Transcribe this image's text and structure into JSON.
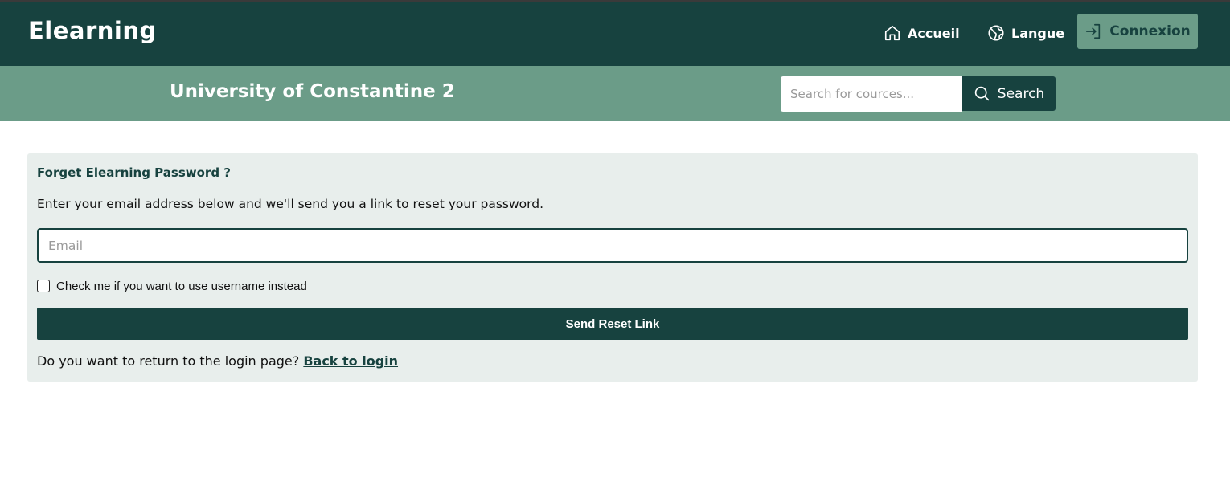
{
  "header": {
    "brand": "Elearning",
    "nav": {
      "home_label": "Accueil",
      "home_icon": "home-icon",
      "language_label": "Langue",
      "language_icon": "globe-icon"
    },
    "login_label": "Connexion",
    "login_icon": "login-arrow-icon"
  },
  "subheader": {
    "title": "University of Constantine 2",
    "search": {
      "placeholder": "Search for cources...",
      "value": "",
      "button_label": "Search",
      "button_icon": "search-icon"
    }
  },
  "reset_form": {
    "title": "Forget Elearning Password ?",
    "description": "Enter your email address below and we'll send you a link to reset your password.",
    "email_placeholder": "Email",
    "email_value": "",
    "checkbox_label": "Check me if you want to use username instead",
    "checkbox_checked": false,
    "submit_label": "Send Reset Link",
    "return_text": "Do you want to return to the login page?",
    "return_link": "Back to login"
  },
  "colors": {
    "primary_dark": "#17423f",
    "accent_green": "#6b9c88",
    "card_bg": "#e8eeec"
  }
}
